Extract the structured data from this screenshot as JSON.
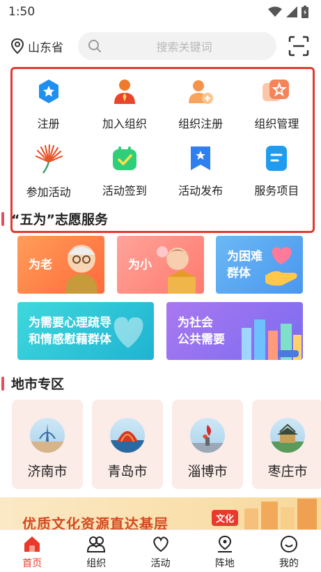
{
  "status": {
    "time": "1:50"
  },
  "header": {
    "location": "山东省",
    "search_placeholder": "搜索关键词"
  },
  "quick_actions": [
    {
      "label": "注册",
      "icon": "star-badge-icon",
      "color": "#1f8ff0"
    },
    {
      "label": "加入组织",
      "icon": "person-tie-icon",
      "color": "#f05a2b"
    },
    {
      "label": "组织注册",
      "icon": "person-add-icon",
      "color": "#f5934a"
    },
    {
      "label": "组织管理",
      "icon": "org-manage-icon",
      "color": "#f58a6a"
    },
    {
      "label": "参加活动",
      "icon": "fan-icon",
      "color": "#e8552b"
    },
    {
      "label": "活动签到",
      "icon": "checkin-icon",
      "color": "#2fcf7a"
    },
    {
      "label": "活动发布",
      "icon": "bookmark-star-icon",
      "color": "#2f7ff0"
    },
    {
      "label": "服务项目",
      "icon": "document-icon",
      "color": "#1f9cf0"
    }
  ],
  "five_for": {
    "title": "“五为”志愿服务",
    "cards": [
      "为老",
      "为小",
      "为困难\n群体",
      "为需要心理疏导\n和情感慰藉群体",
      "为社会\n公共需要"
    ]
  },
  "cities": {
    "title": "地市专区",
    "items": [
      "济南市",
      "青岛市",
      "淄博市",
      "枣庄市"
    ]
  },
  "banner": {
    "text": "优质文化资源直达基层",
    "tag": "文化"
  },
  "tabs": [
    {
      "label": "首页",
      "active": true
    },
    {
      "label": "组织",
      "active": false
    },
    {
      "label": "活动",
      "active": false
    },
    {
      "label": "阵地",
      "active": false
    },
    {
      "label": "我的",
      "active": false
    }
  ]
}
